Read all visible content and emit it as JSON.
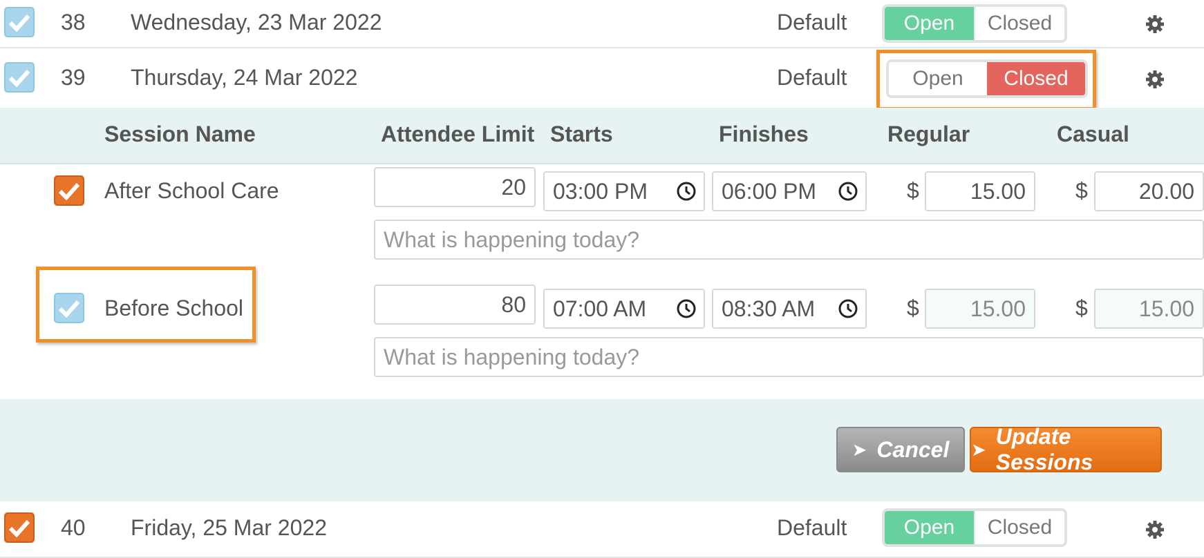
{
  "days": [
    {
      "num": "38",
      "date": "Wednesday, 23 Mar 2022",
      "mode": "Default",
      "status": "open"
    },
    {
      "num": "39",
      "date": "Thursday, 24 Mar 2022",
      "mode": "Default",
      "status": "closed"
    },
    {
      "num": "40",
      "date": "Friday, 25 Mar 2022",
      "mode": "Default",
      "status": "open"
    }
  ],
  "toggle": {
    "open_label": "Open",
    "closed_label": "Closed"
  },
  "sessions_table": {
    "headers": {
      "session_name": "Session Name",
      "attendee_limit": "Attendee Limit",
      "starts": "Starts",
      "finishes": "Finishes",
      "regular": "Regular",
      "casual": "Casual"
    },
    "currency": "$",
    "rows": [
      {
        "name": "After School Care",
        "checked": true,
        "limit": "20",
        "starts": "03:00 PM",
        "finishes": "06:00 PM",
        "regular": "15.00",
        "casual": "20.00",
        "note_placeholder": "What is happening today?"
      },
      {
        "name": "Before School",
        "checked": false,
        "limit": "80",
        "starts": "07:00 AM",
        "finishes": "08:30 AM",
        "regular": "15.00",
        "casual": "15.00",
        "note_placeholder": "What is happening today?"
      }
    ]
  },
  "actions": {
    "cancel": "Cancel",
    "update": "Update Sessions"
  },
  "colors": {
    "open_on": "#66d19e",
    "closed_on": "#e3655d",
    "highlight": "#f0902a",
    "panel_bg": "#e6f3f2",
    "accent": "#e8742a"
  },
  "icons": {
    "settings": "gear-icon",
    "time": "clock-icon",
    "check": "checkmark-icon"
  }
}
